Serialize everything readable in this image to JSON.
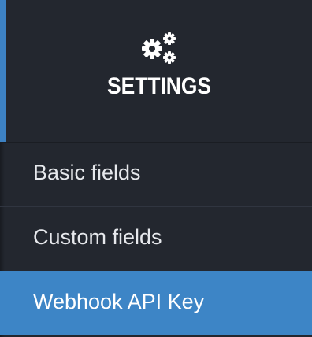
{
  "header": {
    "title": "SETTINGS",
    "icon": "gears-icon"
  },
  "menu": {
    "items": [
      {
        "label": "Basic fields",
        "active": false
      },
      {
        "label": "Custom fields",
        "active": false
      },
      {
        "label": "Webhook API Key",
        "active": true
      }
    ]
  },
  "colors": {
    "background": "#23272f",
    "accent": "#3d85c6",
    "text": "#e6e8ec"
  }
}
